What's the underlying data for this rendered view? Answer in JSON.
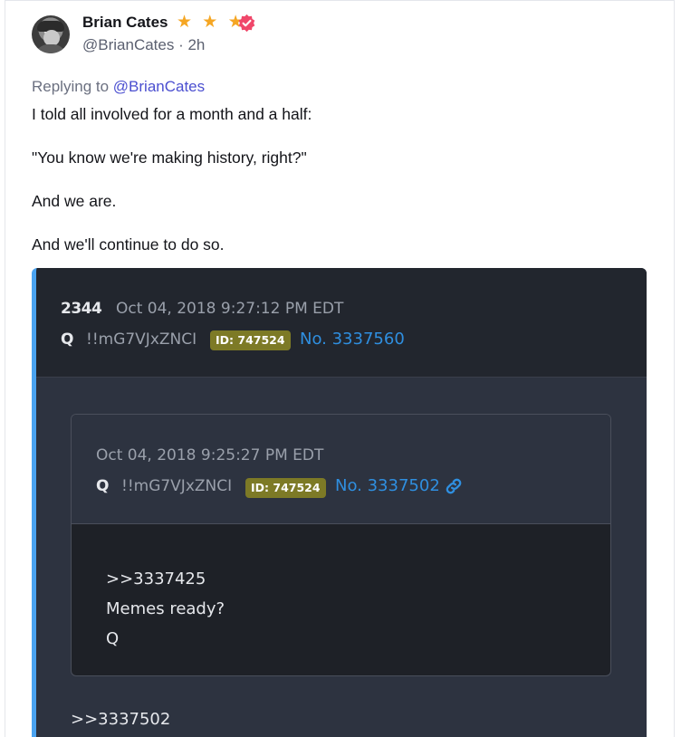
{
  "author": {
    "name": "Brian Cates",
    "stars": "★ ★ ★",
    "handle": "@BrianCates",
    "time_sep": " · ",
    "time": "2h"
  },
  "reply": {
    "prefix": "Replying to ",
    "handle": "@BrianCates"
  },
  "post_text": [
    "I told all involved for a month and a half:",
    "\"You know we're making history, right?\"",
    "And we are.",
    "And we'll continue to do so."
  ],
  "embed": {
    "post_number": "2344",
    "date": "Oct 04, 2018 9:27:12 PM EDT",
    "name": "Q",
    "tripcode": "!!mG7VJxZNCI",
    "id_badge": "ID: 747524",
    "post_no": "No. 3337560",
    "quoted": {
      "date": "Oct 04, 2018 9:25:27 PM EDT",
      "name": "Q",
      "tripcode": "!!mG7VJxZNCI",
      "id_badge": "ID: 747524",
      "post_no": "No. 3337502",
      "lines": [
        ">>3337425",
        "Memes ready?",
        "Q"
      ]
    },
    "body_first_line": ">>3337502"
  },
  "colors": {
    "accent": "#4aa3f0",
    "link": "#2f8fe0",
    "badge": "#7d7a26",
    "star": "#f5a623",
    "verified": "#f0476a"
  }
}
